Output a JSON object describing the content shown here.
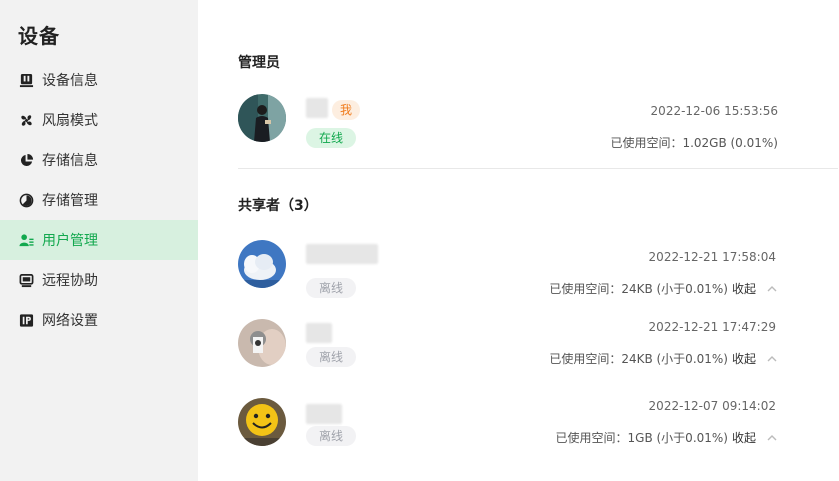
{
  "sidebar": {
    "title": "设备",
    "items": [
      {
        "label": "设备信息",
        "icon": "device-info-icon"
      },
      {
        "label": "风扇模式",
        "icon": "fan-icon"
      },
      {
        "label": "存储信息",
        "icon": "storage-pie-icon"
      },
      {
        "label": "存储管理",
        "icon": "storage-manage-icon"
      },
      {
        "label": "用户管理",
        "icon": "user-manage-icon",
        "active": true
      },
      {
        "label": "远程协助",
        "icon": "remote-monitor-icon"
      },
      {
        "label": "网络设置",
        "icon": "ip-icon"
      }
    ]
  },
  "admin": {
    "section_title": "管理员",
    "user": {
      "me_tag": "我",
      "status": "在线",
      "date": "2022-12-06 15:53:56",
      "usage": "已使用空间：1.02GB (0.01%)"
    }
  },
  "sharers": {
    "section_title": "共享者（3）",
    "collapse_label": "收起",
    "users": [
      {
        "status": "离线",
        "date": "2022-12-21 17:58:04",
        "usage": "已使用空间：24KB (小于0.01%)"
      },
      {
        "status": "离线",
        "date": "2022-12-21 17:47:29",
        "usage": "已使用空间：24KB (小于0.01%)"
      },
      {
        "status": "离线",
        "date": "2022-12-07 09:14:02",
        "usage": "已使用空间：1GB (小于0.01%)"
      }
    ]
  },
  "colors": {
    "accent": "#12a84e",
    "active_bg": "#d7f0df",
    "me_tag": "#f07c1e"
  }
}
